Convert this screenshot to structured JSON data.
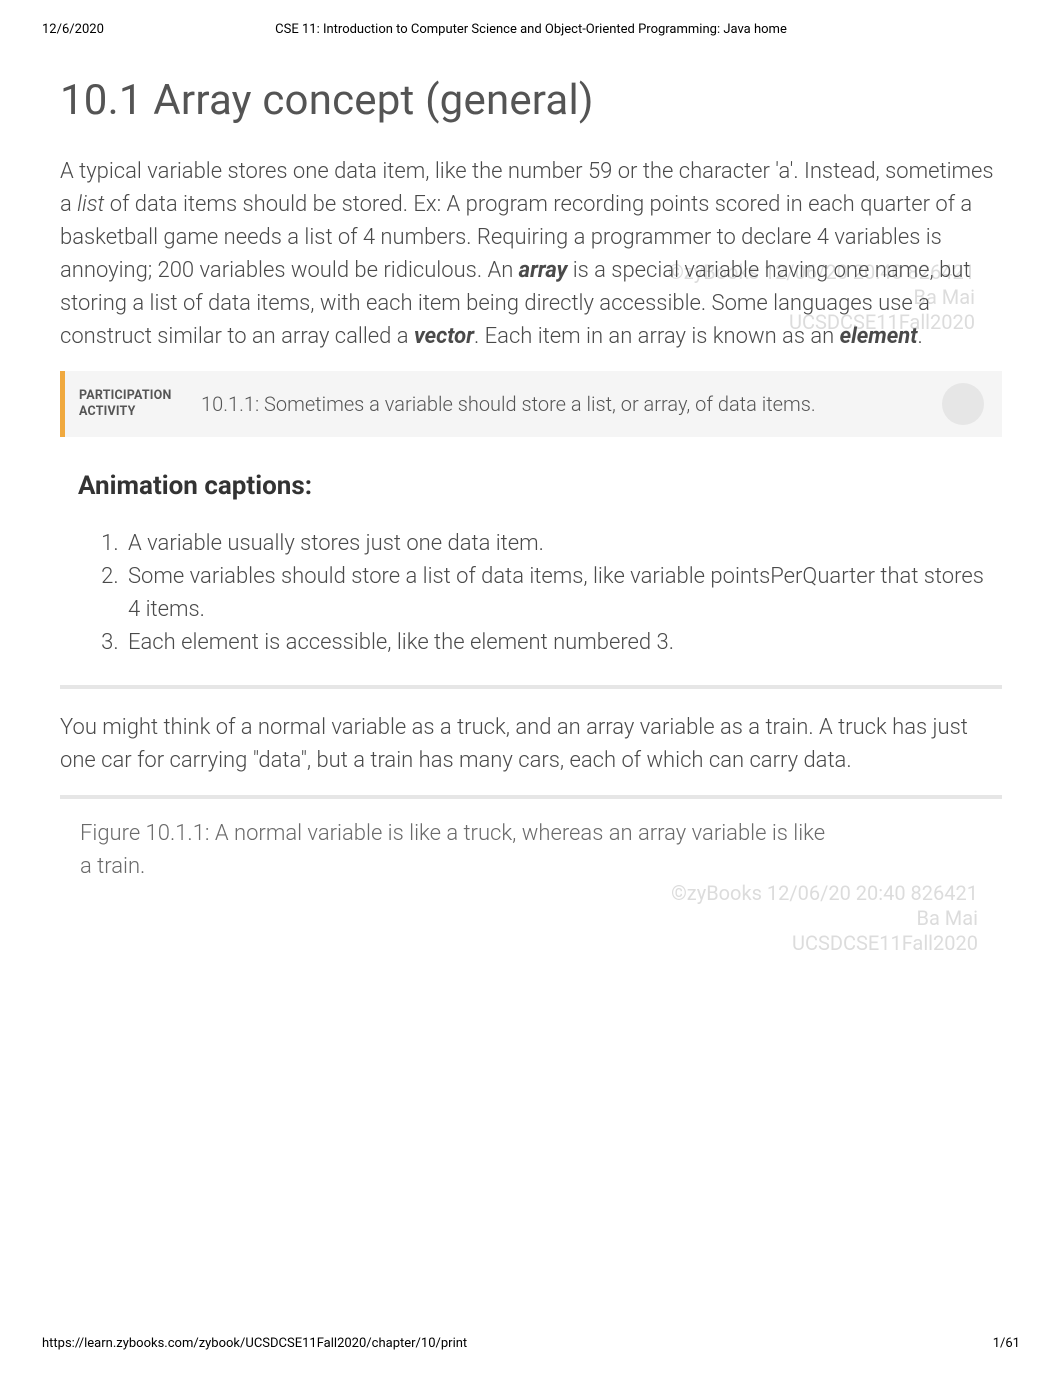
{
  "print_header": {
    "date": "12/6/2020",
    "title": "CSE 11: Introduction to Computer Science and Object-Oriented Programming: Java home"
  },
  "print_footer": {
    "url": "https://learn.zybooks.com/zybook/UCSDCSE11Fall2020/chapter/10/print",
    "page": "1/61"
  },
  "section": {
    "title": "10.1 Array concept (general)"
  },
  "para1": {
    "pre": "A typical variable stores one data item, like the number 59 or the character 'a'. Instead, sometimes a ",
    "list_word": "list",
    "mid1": " of data items should be stored. Ex: A program recording points scored in each quarter of a basketball game needs a list of 4 numbers. Requiring a programmer to declare 4 variables is annoying; 200 variables would be ridiculous. An ",
    "array_word": "array",
    "mid2": " is a special variable having one name, but storing a list of data items, with each item being directly accessible. Some languages use a construct similar to an array called a ",
    "vector_word": "vector",
    "mid3": ". Each item in an array is known as an ",
    "element_word": "element",
    "end": "."
  },
  "activity": {
    "label_line1": "PARTICIPATION",
    "label_line2": "ACTIVITY",
    "title": "10.1.1: Sometimes a variable should store a list, or array, of data items."
  },
  "captions": {
    "heading": "Animation captions:",
    "items": [
      "A variable usually stores just one data item.",
      "Some variables should store a list of data items, like variable pointsPerQuarter that stores 4 items.",
      "Each element is accessible, like the element numbered 3."
    ]
  },
  "para2": "You might think of a normal variable as a truck, and an array variable as a train. A truck has just one car for carrying \"data\", but a train has many cars, each of which can carry data.",
  "figure": {
    "title": "Figure 10.1.1: A normal variable is like a truck, whereas an array variable is like a train."
  },
  "watermark": {
    "line1": "©zyBooks 12/06/20 20:40 826421",
    "line2": "Ba Mai",
    "line3": "UCSDCSE11Fall2020"
  }
}
